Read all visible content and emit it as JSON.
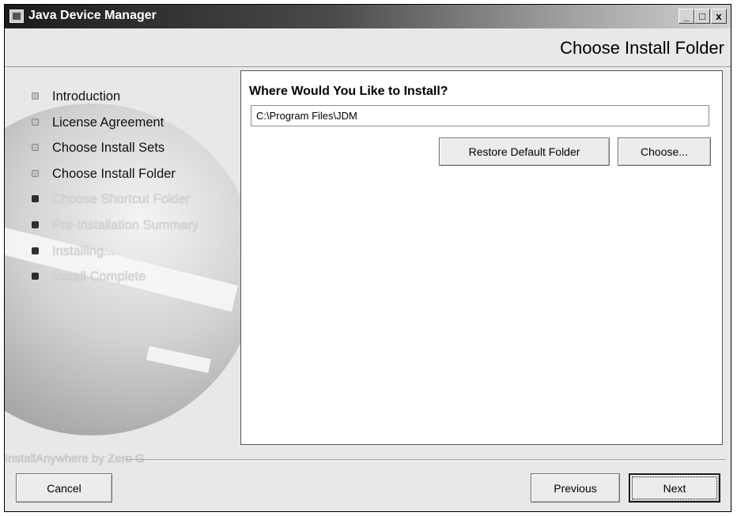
{
  "window": {
    "title": "Java Device Manager",
    "controls": {
      "minimize": "_",
      "maximize": "□",
      "close": "x"
    }
  },
  "header": {
    "title": "Choose Install Folder"
  },
  "steps": [
    {
      "label": "Introduction",
      "state": "done"
    },
    {
      "label": "License Agreement",
      "state": "done"
    },
    {
      "label": "Choose Install Sets",
      "state": "done"
    },
    {
      "label": "Choose Install Folder",
      "state": "current"
    },
    {
      "label": "Choose Shortcut Folder",
      "state": "pending"
    },
    {
      "label": "Pre-Installation Summary",
      "state": "pending"
    },
    {
      "label": "Installing...",
      "state": "pending"
    },
    {
      "label": "Install Complete",
      "state": "pending"
    }
  ],
  "content": {
    "heading": "Where Would You Like to Install?",
    "install_path": "C:\\Program Files\\JDM",
    "restore_button": "Restore Default Folder",
    "choose_button": "Choose..."
  },
  "footer": {
    "vendor": "InstallAnywhere by Zero G",
    "cancel": "Cancel",
    "previous": "Previous",
    "next": "Next"
  }
}
